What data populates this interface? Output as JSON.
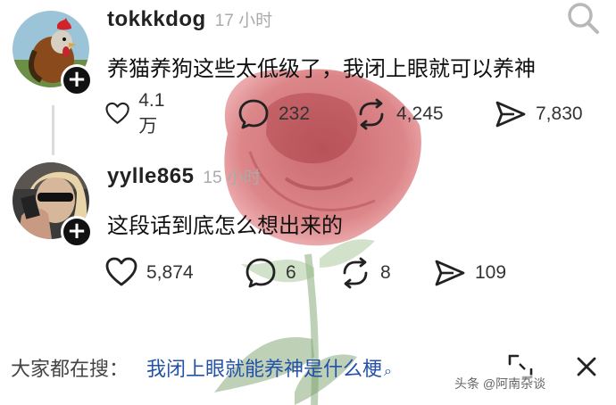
{
  "posts": [
    {
      "username": "tokkkdog",
      "time": "17 小时",
      "content": "养猫养狗这些太低级了，我闭上眼就可以养神",
      "likes": "4.1万",
      "comments": "232",
      "reposts": "4,245",
      "shares": "7,830"
    },
    {
      "username": "yylle865",
      "time": "15 小时",
      "content": "这段话到底怎么想出来的",
      "likes": "5,874",
      "comments": "6",
      "reposts": "8",
      "shares": "109"
    }
  ],
  "search_bar": {
    "prefix": "大家都在搜：",
    "query": "我闭上眼就能养神是什么梗"
  },
  "watermark": "头条 @阿南杂谈",
  "colors": {
    "link": "#2352a8",
    "badge": "#111111",
    "rose": "#c0262b"
  },
  "icons": [
    "search-icon",
    "plus-icon",
    "heart-icon",
    "comment-icon",
    "repost-icon",
    "share-icon",
    "expand-icon",
    "close-icon"
  ]
}
